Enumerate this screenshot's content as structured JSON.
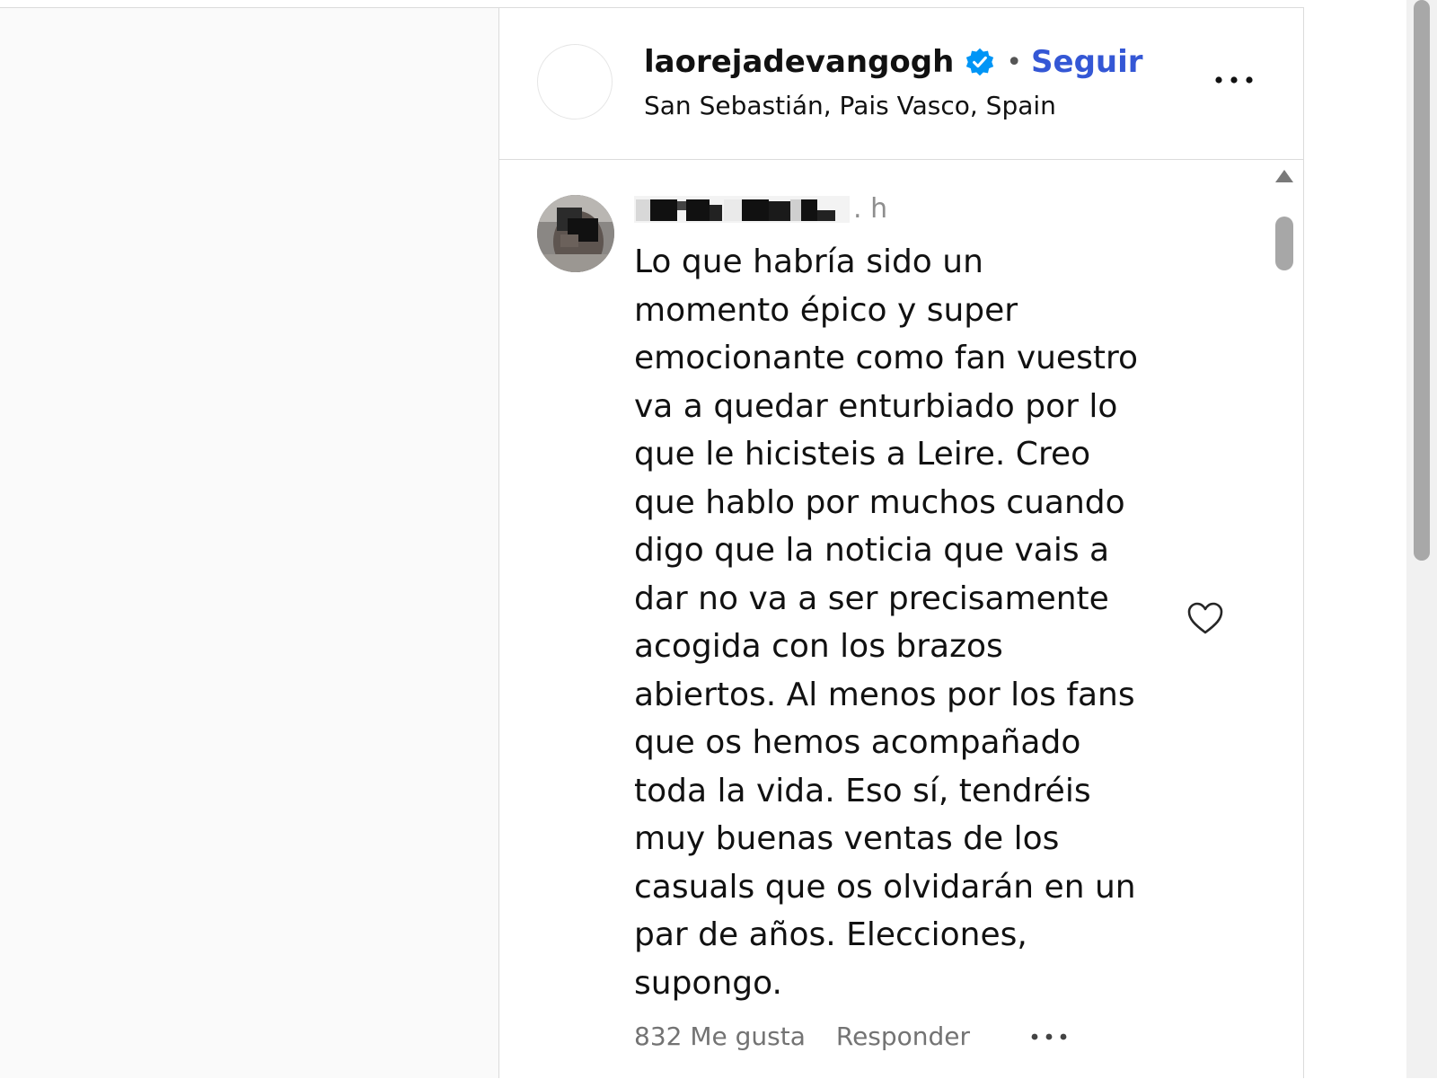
{
  "post": {
    "username": "laorejadevangogh",
    "separator": "•",
    "follow_label": "Seguir",
    "location": "San Sebastián, Pais Vasco, Spain",
    "verified": true
  },
  "comment": {
    "timestamp": ". h",
    "text_lines": [
      "Lo que habría sido un",
      "momento épico y super",
      "emocionante como fan vuestro",
      "va a quedar enturbiado por lo",
      "que le hicisteis a Leire. Creo",
      "que hablo por muchos cuando",
      "digo que la noticia que vais a",
      "dar no va a ser precisamente",
      "acogida con los brazos",
      "abiertos. Al menos por los fans",
      "que os hemos acompañado",
      "toda la vida. Eso sí, tendréis",
      "muy buenas ventas de los",
      "casuals que os olvidarán en un",
      "par de años. Elecciones,",
      "supongo."
    ],
    "likes_label": "832 Me gusta",
    "reply_label": "Responder"
  },
  "colors": {
    "follow": "#3457d5",
    "verified": "#0095f6",
    "secondary_text": "#737373"
  },
  "icons": [
    "verified-badge-icon",
    "more-options-icon",
    "heart-icon",
    "scroll-up-arrow-icon"
  ]
}
